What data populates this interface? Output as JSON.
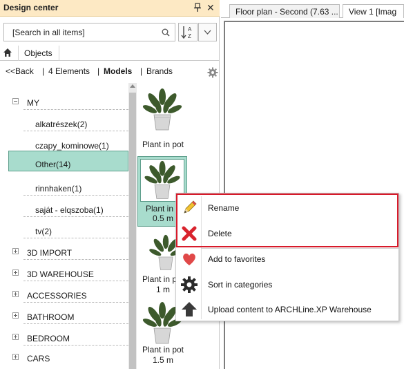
{
  "panel": {
    "title": "Design center",
    "search_placeholder": "[Search in all items]",
    "objects_tab": "Objects"
  },
  "nav": {
    "back": "<<Back",
    "sep1": "|",
    "elements": "4 Elements",
    "sep2": "|",
    "models": "Models",
    "sep3": "|",
    "brands": "Brands"
  },
  "tree": {
    "my": "MY",
    "items": [
      "alkatrészek(2)",
      "czapy_kominowe(1)",
      "Other(14)",
      "rinnhaken(1)",
      "saját - elqszoba(1)",
      "tv(2)"
    ],
    "categories": [
      "3D IMPORT",
      "3D WAREHOUSE",
      "ACCESSORIES",
      "BATHROOM",
      "BEDROOM",
      "CARS"
    ]
  },
  "thumbnails": [
    {
      "name": "Plant in pot",
      "size": ""
    },
    {
      "name": "Plant in p",
      "size": "0.5 m"
    },
    {
      "name": "Plant in pot",
      "size": "1 m"
    },
    {
      "name": "Plant in pot",
      "size": "1.5 m"
    }
  ],
  "doc_tabs": [
    "Floor plan - Second (7.63 ...",
    "View 1 [Imag"
  ],
  "context_menu": [
    {
      "label": "Rename",
      "icon": "pencil-icon"
    },
    {
      "label": "Delete",
      "icon": "red-x-icon"
    },
    {
      "label": "Add to favorites",
      "icon": "heart-icon"
    },
    {
      "label": "Sort in categories",
      "icon": "gear-icon"
    },
    {
      "label": "Upload content to ARCHLine.XP Warehouse",
      "icon": "upload-icon"
    }
  ],
  "colors": {
    "title_bar": "#fde9c4",
    "selection": "#a8dccd",
    "highlight_box": "#d71a2a"
  }
}
